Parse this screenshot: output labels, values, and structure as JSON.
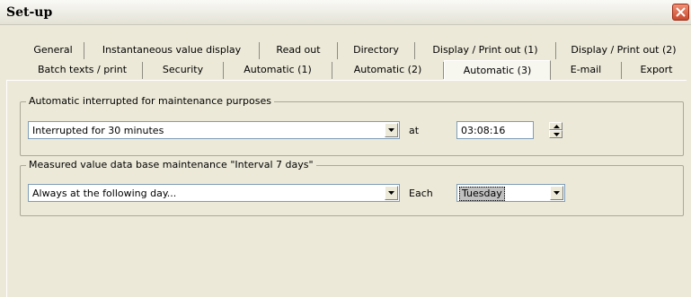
{
  "window": {
    "title": "Set-up"
  },
  "tabs_row1": [
    {
      "label": "General"
    },
    {
      "label": "Instantaneous value display"
    },
    {
      "label": "Read out"
    },
    {
      "label": "Directory"
    },
    {
      "label": "Display / Print out (1)"
    },
    {
      "label": "Display / Print out (2)"
    }
  ],
  "tabs_row2": [
    {
      "label": "Batch texts / print"
    },
    {
      "label": "Security"
    },
    {
      "label": "Automatic (1)"
    },
    {
      "label": "Automatic (2)"
    },
    {
      "label": "Automatic (3)",
      "selected": true
    },
    {
      "label": "E-mail"
    },
    {
      "label": "Export"
    }
  ],
  "group_interrupt": {
    "legend": "Automatic interrupted for maintenance purposes",
    "mode_value": "Interrupted for 30 minutes",
    "at_label": "at",
    "time_value": "03:08:16"
  },
  "group_db": {
    "legend": "Measured value data base maintenance \"Interval 7 days\"",
    "mode_value": "Always at the following day...",
    "each_label": "Each",
    "day_value": "Tuesday"
  },
  "icons": {
    "close": "close-icon",
    "dropdown": "dropdown-arrow-icon",
    "spin_up": "spin-up-icon",
    "spin_down": "spin-down-icon"
  },
  "colors": {
    "window_bg": "#ece9d8",
    "close_red": "#d9543a",
    "field_border": "#7f9db9"
  }
}
